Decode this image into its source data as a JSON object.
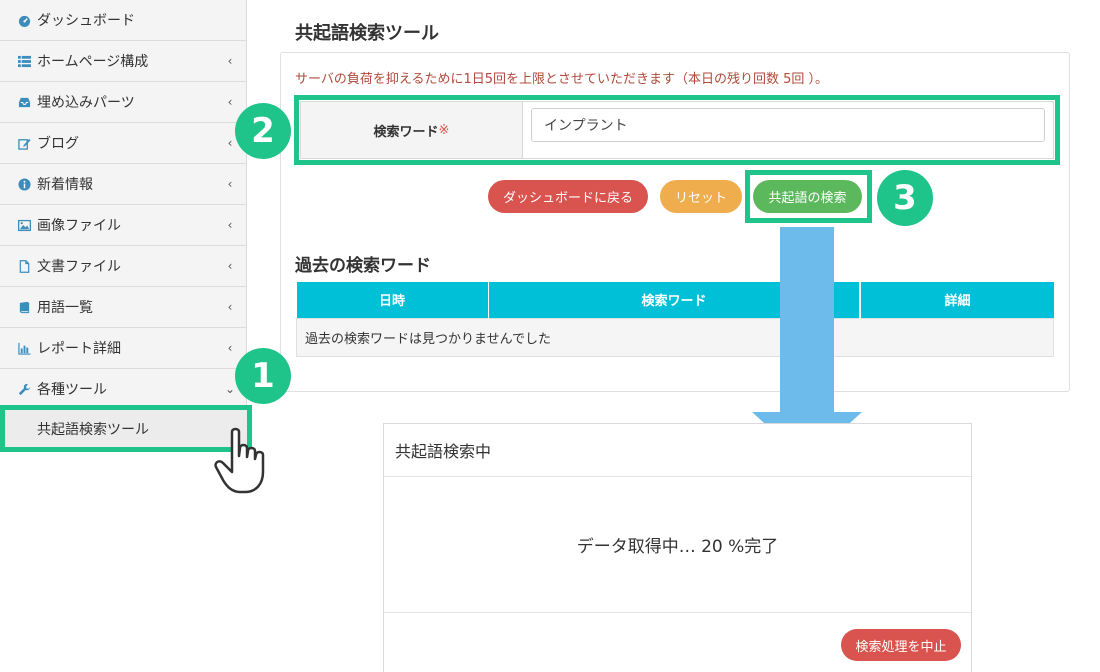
{
  "sidebar": {
    "items": [
      {
        "label": "ダッシュボード",
        "icon": "dashboard-icon",
        "chevron": ""
      },
      {
        "label": "ホームページ構成",
        "icon": "list-icon",
        "chevron": "‹"
      },
      {
        "label": "埋め込みパーツ",
        "icon": "inbox-icon",
        "chevron": "‹"
      },
      {
        "label": "ブログ",
        "icon": "edit-icon",
        "chevron": "‹"
      },
      {
        "label": "新着情報",
        "icon": "info-icon",
        "chevron": "‹"
      },
      {
        "label": "画像ファイル",
        "icon": "image-icon",
        "chevron": "‹"
      },
      {
        "label": "文書ファイル",
        "icon": "file-icon",
        "chevron": "‹"
      },
      {
        "label": "用語一覧",
        "icon": "book-icon",
        "chevron": "‹"
      },
      {
        "label": "レポート詳細",
        "icon": "bar-chart-icon",
        "chevron": "‹"
      },
      {
        "label": "各種ツール",
        "icon": "wrench-icon",
        "chevron": "⌄"
      }
    ],
    "sub_item": "共起語検索ツール"
  },
  "main": {
    "title": "共起語検索ツール",
    "notice": "サーバの負荷を抑えるために1日5回を上限とさせていただきます（本日の残り回数 5回 ）。",
    "form": {
      "label": "検索ワード",
      "required_mark": "※",
      "value": "インプラント"
    },
    "buttons": {
      "back": "ダッシュボードに戻る",
      "reset": "リセット",
      "search": "共起語の検索"
    },
    "history": {
      "title": "過去の検索ワード",
      "columns": [
        "日時",
        "検索ワード",
        "",
        "詳細"
      ],
      "empty_message": "過去の検索ワードは見つかりませんでした"
    }
  },
  "modal": {
    "title": "共起語検索中",
    "progress_text": "データ取得中… 20 %完了",
    "progress_percent": 20,
    "cancel_button": "検索処理を中止"
  },
  "annotations": {
    "step1": "1",
    "step2": "2",
    "step3": "3"
  },
  "colors": {
    "highlight": "#1ec48a",
    "table_header": "#00c0d8",
    "arrow": "#6cbbea",
    "danger": "#d9534f",
    "warning": "#f0ad4e",
    "success": "#5cb85c"
  }
}
